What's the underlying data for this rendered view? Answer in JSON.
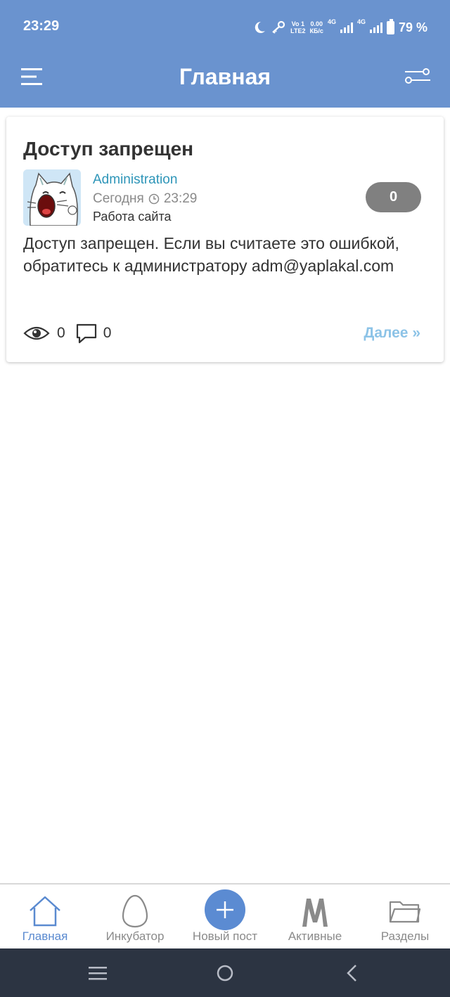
{
  "status_bar": {
    "time": "23:29",
    "volte": "Vo 1",
    "lte": "LTE2",
    "speed_value": "0.00",
    "speed_unit": "КБ/с",
    "net1": "4G",
    "net2": "4G",
    "battery": "79 %",
    "icons": [
      "moon-icon",
      "key-icon",
      "signal-icon",
      "battery-icon"
    ]
  },
  "app_bar": {
    "title": "Главная",
    "icons": [
      "menu-icon",
      "filter-icon"
    ]
  },
  "post": {
    "title": "Доступ запрещен",
    "author": "Administration",
    "date": "Сегодня",
    "time": "23:29",
    "section": "Работа сайта",
    "rating": "0",
    "body": "Доступ запрещен. Если вы считаете это ошибкой, обратитесь к администратору adm@yaplakal.com",
    "views": "0",
    "comments": "0",
    "more_label": "Далее »"
  },
  "bottom_nav": {
    "items": [
      {
        "label": "Главная",
        "icon": "home-icon",
        "active": true
      },
      {
        "label": "Инкубатор",
        "icon": "egg-icon",
        "active": false
      },
      {
        "label": "Новый пост",
        "icon": "plus-icon",
        "active": false
      },
      {
        "label": "Активные",
        "icon": "active-m-icon",
        "active": false
      },
      {
        "label": "Разделы",
        "icon": "folder-icon",
        "active": false
      }
    ]
  },
  "colors": {
    "primary": "#6a93cf",
    "link": "#2d95b8",
    "more": "#8cc3e7",
    "active_nav": "#5a8ad0",
    "system_nav": "#2c3442"
  }
}
